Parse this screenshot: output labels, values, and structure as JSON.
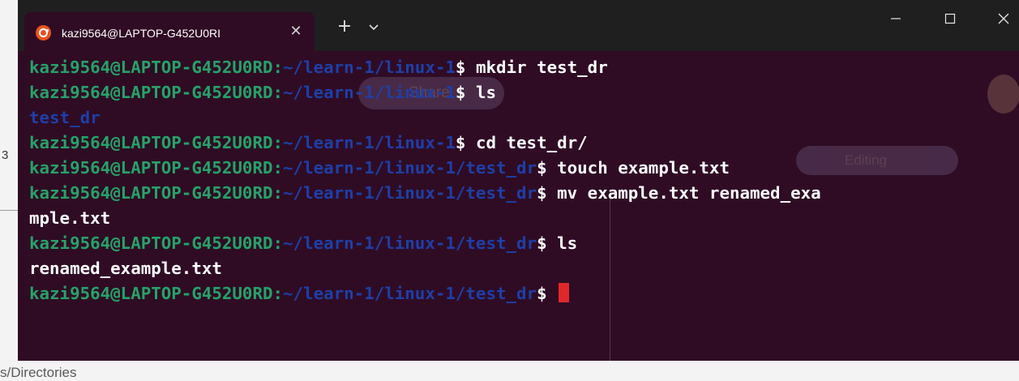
{
  "background_doc": {
    "bottom_text": "s/Directories",
    "side_glyph": "3"
  },
  "window": {
    "tab_title": "kazi9564@LAPTOP-G452U0RI",
    "tab_close_glyph": "✕",
    "new_tab_glyph": "+",
    "icons": {
      "tab": "ubuntu-icon",
      "new_tab": "plus-icon",
      "dropdown": "chevron-down-icon",
      "minimize": "minimize-icon",
      "maximize": "maximize-icon",
      "close": "close-icon"
    }
  },
  "ghost": {
    "share_label": "Share",
    "editing_label": "Editing"
  },
  "colors": {
    "terminal_bg": "#2f0c24",
    "prompt_user": "#26a269",
    "prompt_path": "#1e3fa8",
    "cursor": "#e0282a",
    "titlebar": "#1f1f1f"
  },
  "terminal": {
    "prompt_user": "kazi9564@LAPTOP-G452U0RD",
    "lines": [
      {
        "path": "~/learn-1/linux-1",
        "cmd": "mkdir test_dr"
      },
      {
        "path": "~/learn-1/linux-1",
        "cmd": "ls"
      },
      {
        "output_dir": "test_dr"
      },
      {
        "path": "~/learn-1/linux-1",
        "cmd": "cd test_dr/"
      },
      {
        "path": "~/learn-1/linux-1/test_dr",
        "cmd": "touch example.txt"
      },
      {
        "path": "~/learn-1/linux-1/test_dr",
        "cmd": "mv example.txt renamed_exa"
      },
      {
        "output": "mple.txt"
      },
      {
        "path": "~/learn-1/linux-1/test_dr",
        "cmd": "ls"
      },
      {
        "output": "renamed_example.txt"
      },
      {
        "path": "~/learn-1/linux-1/test_dr",
        "cmd": ""
      }
    ],
    "colon": ":",
    "dollar": "$"
  }
}
